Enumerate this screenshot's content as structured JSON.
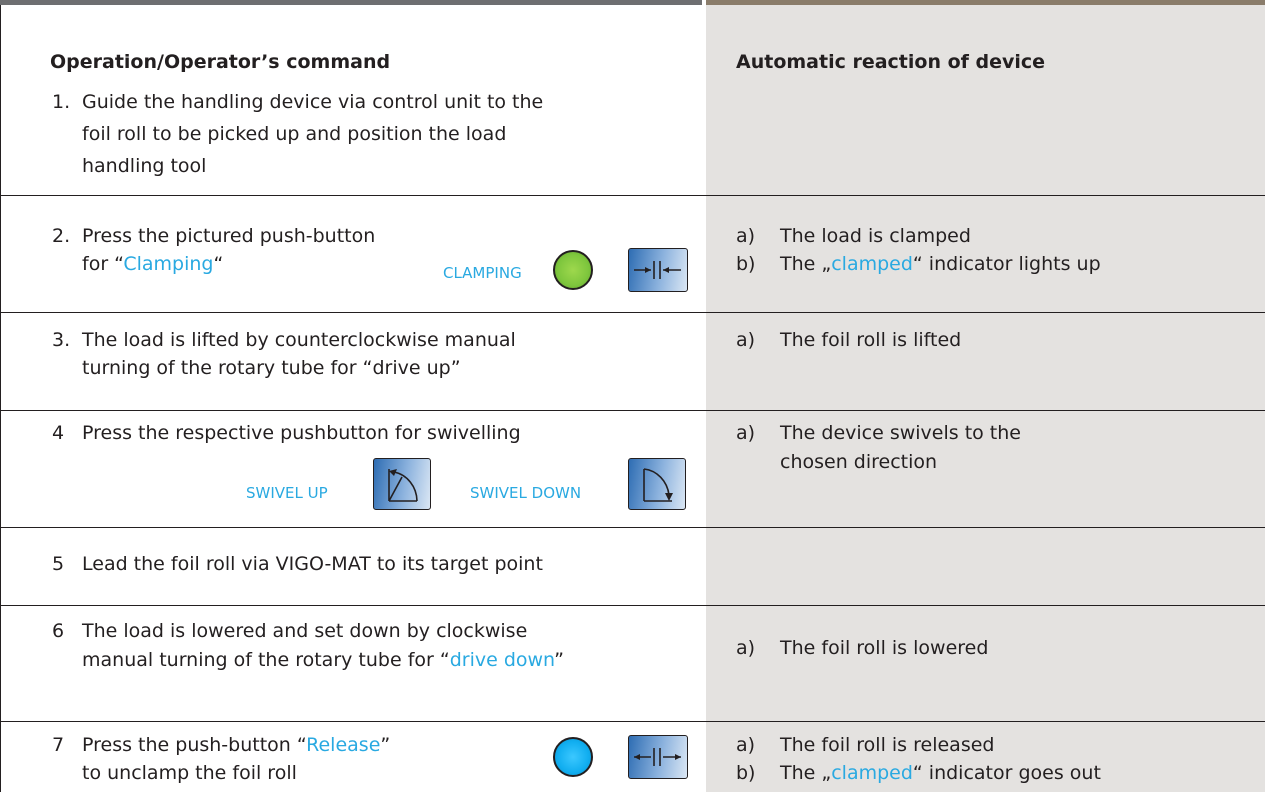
{
  "headers": {
    "left": "Operation/Operator’s command",
    "right": "Automatic reaction of device"
  },
  "rows": [
    {
      "num": "1.",
      "op_lines": [
        "Guide the handling device via control unit to the",
        "foil roll to be picked up and position the load",
        "handling tool"
      ]
    },
    {
      "num": "2.",
      "op_line1": "Press the pictured push-button",
      "op_line2_pre": "for “",
      "op_line2_hl": "Clamping",
      "op_line2_post": "“",
      "button_label": "CLAMPING",
      "reactions": [
        {
          "letter": "a)",
          "text": "The load is clamped"
        },
        {
          "letter": "b)",
          "pre": "The „",
          "hl": "clamped",
          "post": "“ indicator lights up"
        }
      ]
    },
    {
      "num": "3.",
      "op_lines": [
        "The load is lifted by counterclockwise manual",
        "turning of the rotary tube for “drive up”"
      ],
      "reactions": [
        {
          "letter": "a)",
          "text": "The foil roll is lifted"
        }
      ]
    },
    {
      "num": "4",
      "op_line1": "Press the respective pushbutton for swivelling",
      "button_up_label": "SWIVEL UP",
      "button_down_label": "SWIVEL DOWN",
      "reactions": [
        {
          "letter": "a)",
          "lines": [
            "The device swivels to the",
            "chosen direction"
          ]
        }
      ]
    },
    {
      "num": "5",
      "op_line1": "Lead the foil roll via VIGO-MAT to its target point"
    },
    {
      "num": "6",
      "op_line1": "The load is lowered and set down by clockwise",
      "op_line2_pre": "manual turning of the rotary tube for “",
      "op_line2_hl": "drive down",
      "op_line2_post": "”",
      "reactions": [
        {
          "letter": "a)",
          "text": "The foil roll is lowered"
        }
      ]
    },
    {
      "num": "7",
      "op_line1_pre": "Press the push-button “",
      "op_line1_hl": "Release",
      "op_line1_post": "”",
      "op_line2": "to unclamp the foil roll",
      "reactions": [
        {
          "letter": "a)",
          "text": "The foil roll is released"
        },
        {
          "letter": "b)",
          "pre": "The „",
          "hl": "clamped",
          "post": "“ indicator goes out"
        }
      ]
    }
  ],
  "colors": {
    "highlight": "#29a9e1",
    "lamp_green": "#7ec63d",
    "lamp_blue": "#11aef0",
    "right_column_bg": "#e4e2e0"
  }
}
